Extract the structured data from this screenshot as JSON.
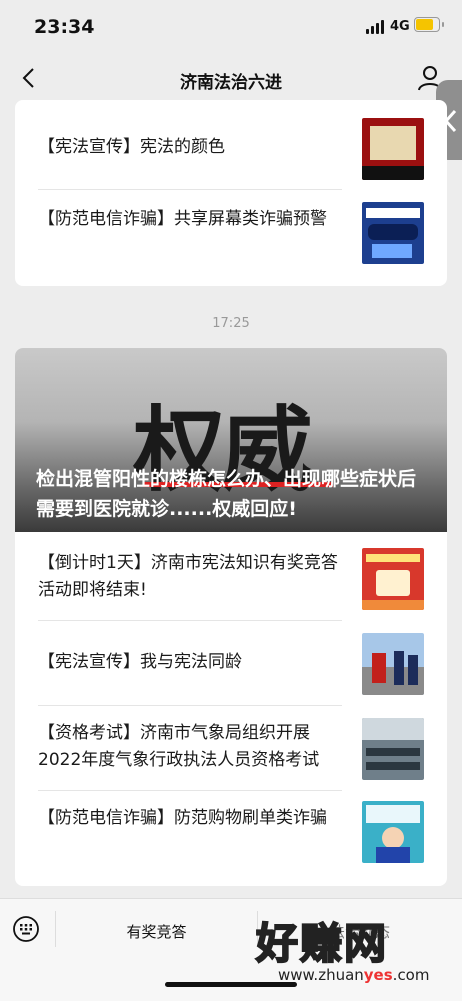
{
  "status": {
    "time": "23:34",
    "network": "4G"
  },
  "nav": {
    "title": "济南法治六进"
  },
  "card1": {
    "items": [
      {
        "title": "【宪法宣传】宪法的颜色"
      },
      {
        "title": "【防范电信诈骗】共享屏幕类诈骗预警"
      }
    ]
  },
  "timestamp": "17:25",
  "card2": {
    "hero": {
      "overlay_text": "权威",
      "headline": "检出混管阳性的楼栋怎么办、出现哪些症状后需要到医院就诊......权威回应!"
    },
    "items": [
      {
        "title": "【倒计时1天】济南市宪法知识有奖竞答活动即将结束!"
      },
      {
        "title": "【宪法宣传】我与宪法同龄"
      },
      {
        "title": "【资格考试】济南市气象局组织开展2022年度气象行政执法人员资格考试"
      },
      {
        "title": "【防范电信诈骗】防范购物刷单类诈骗"
      }
    ]
  },
  "bottom_menu": {
    "item1": "有奖竞答",
    "item2": "法治动态"
  },
  "watermark": {
    "text": "好赚网",
    "url_a": "www.zhuan",
    "url_b": "yes",
    "url_c": ".com"
  },
  "colors": {
    "accent_red": "#d22222",
    "battery": "#f5c400"
  }
}
